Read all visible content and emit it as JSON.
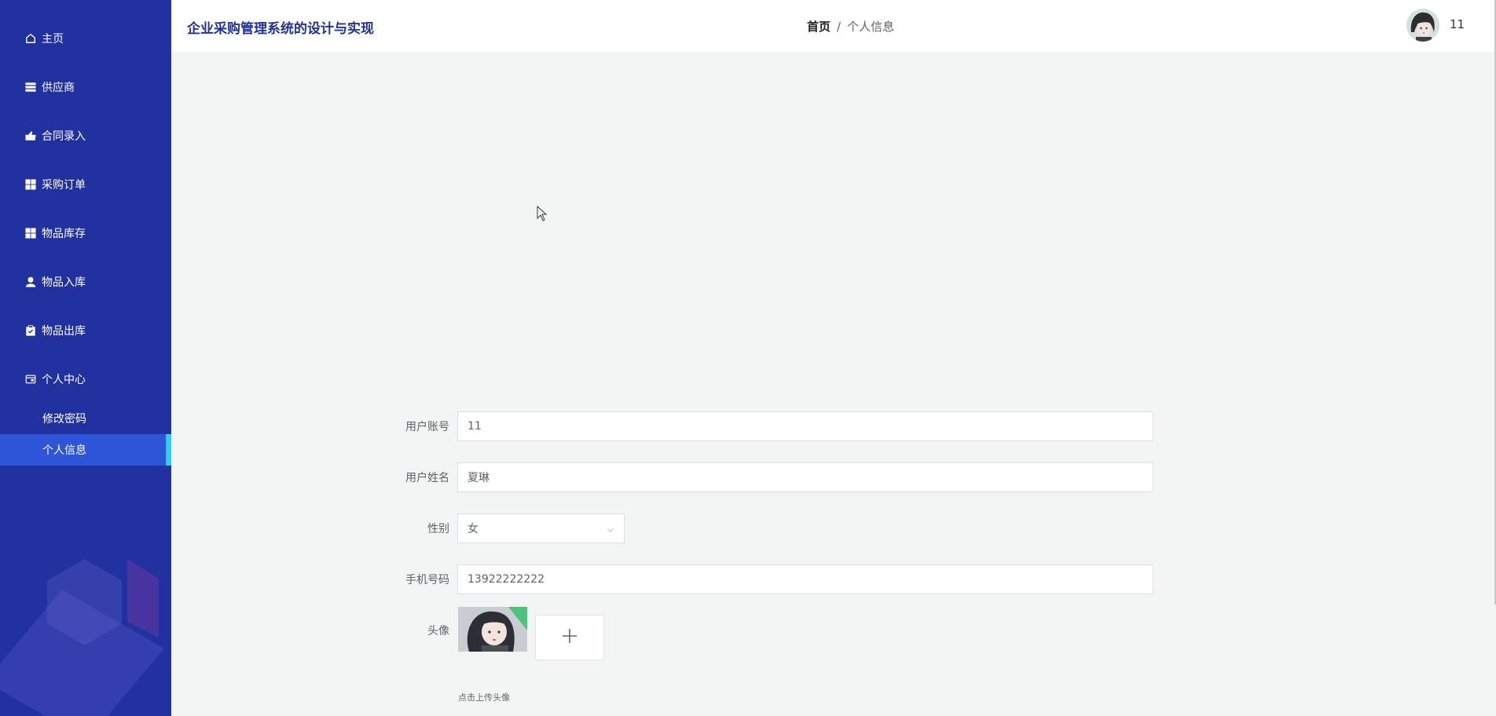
{
  "sidebar": {
    "items": [
      {
        "label": "主页",
        "icon": "home-icon"
      },
      {
        "label": "供应商",
        "icon": "list-icon"
      },
      {
        "label": "合同录入",
        "icon": "thumb-icon"
      },
      {
        "label": "采购订单",
        "icon": "grid-icon"
      },
      {
        "label": "物品库存",
        "icon": "grid-icon"
      },
      {
        "label": "物品入库",
        "icon": "user-icon"
      },
      {
        "label": "物品出库",
        "icon": "clipboard-icon"
      },
      {
        "label": "个人中心",
        "icon": "wallet-icon"
      }
    ],
    "sub_items": [
      {
        "label": "修改密码"
      },
      {
        "label": "个人信息",
        "active": true
      }
    ],
    "bg_color": "#2231a0",
    "active_color": "#2e55d8",
    "accent_color": "#25d3f1"
  },
  "header": {
    "title": "企业采购管理系统的设计与实现",
    "breadcrumb": {
      "home": "首页",
      "separator": "/",
      "current": "个人信息"
    },
    "username": "11"
  },
  "form": {
    "account": {
      "label": "用户账号",
      "value": "11"
    },
    "name": {
      "label": "用户姓名",
      "value": "夏琳"
    },
    "gender": {
      "label": "性别",
      "value": "女"
    },
    "phone": {
      "label": "手机号码",
      "value": "13922222222"
    },
    "avatar": {
      "label": "头像",
      "upload_icon": "plus-icon",
      "hint": "点击上传头像"
    }
  }
}
